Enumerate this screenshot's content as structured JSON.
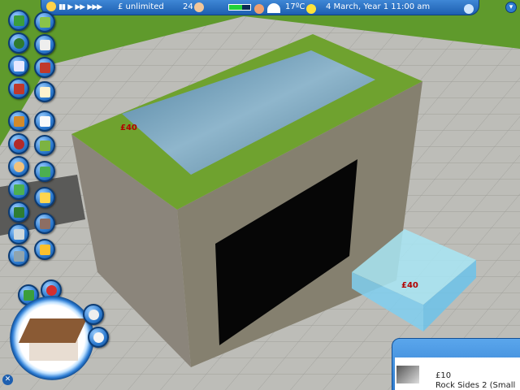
{
  "status_bar": {
    "money": "£ unlimited",
    "guests": "24",
    "temperature": "17ºC",
    "date_time": "4 March, Year 1  11:00 am",
    "park_rating_level": 0.6
  },
  "world": {
    "price_tag_box": "£40",
    "price_tag_ghost": "£40"
  },
  "shop_panel": {
    "price": "£10",
    "item_name": "Rock Sides 2 (Small"
  },
  "icons": {
    "sidebar_left": [
      "park-icon",
      "bushes-icon",
      "cards-icon",
      "paint-icon",
      "clipboard-icon",
      "info-icon",
      "character-icon",
      "camera-icon",
      "move-icon",
      "pathway-icon",
      "spanner-icon",
      "trash-icon"
    ],
    "sidebar_right": [
      "scenery-icon",
      "fence-icon",
      "wall-icon",
      "notebook-icon",
      "list-icon",
      "dice-icon",
      "terrain-icon",
      "landscape-icon",
      "sign-icon",
      "chest-icon",
      "tools-icon"
    ]
  },
  "colors": {
    "ui_blue": "#2d7bd0",
    "grass": "#5f9a2c",
    "paving": "#b9b9b4",
    "water": "#6fa6c8"
  }
}
